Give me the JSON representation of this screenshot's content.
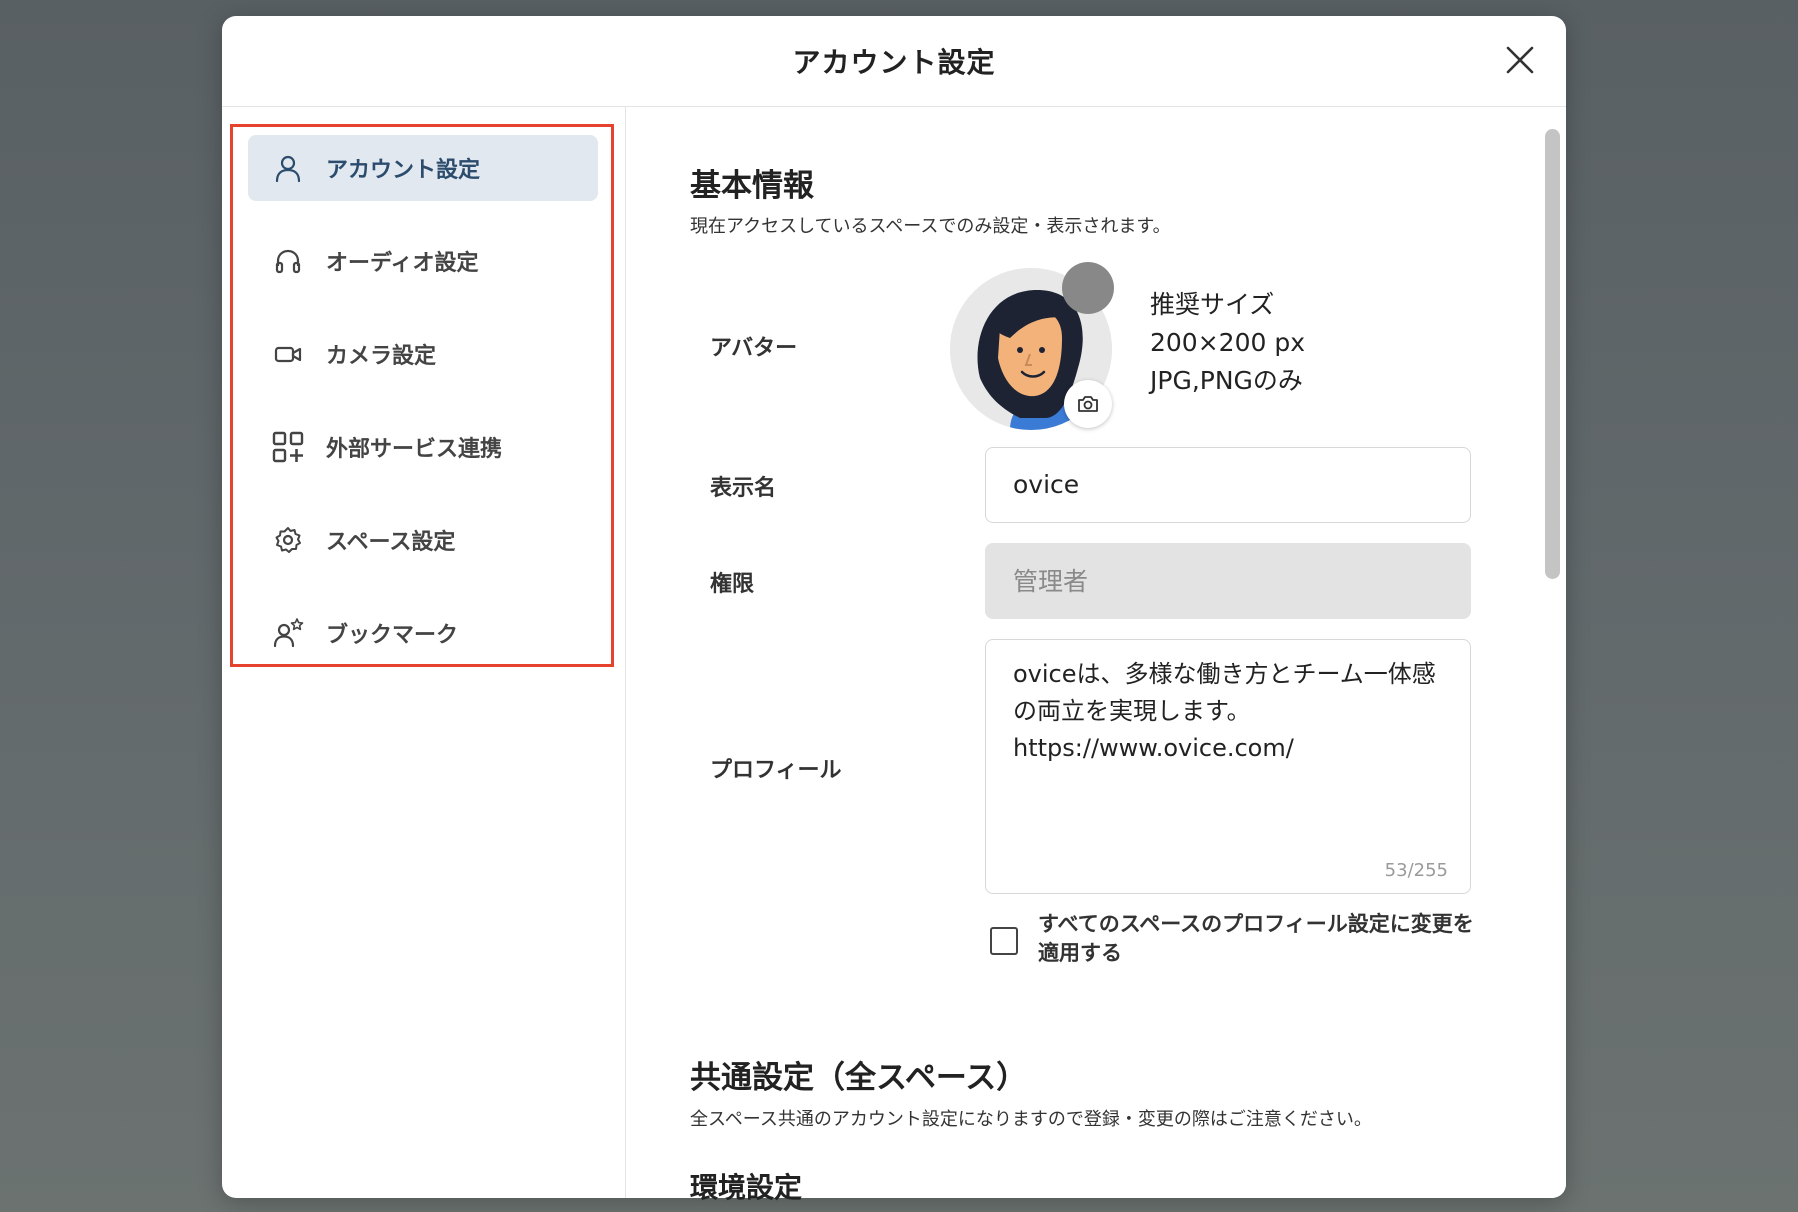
{
  "modal": {
    "title": "アカウント設定",
    "close_icon": "close-icon"
  },
  "sidebar": {
    "items": [
      {
        "label": "アカウント設定",
        "icon": "user-icon",
        "active": true
      },
      {
        "label": "オーディオ設定",
        "icon": "headphones-icon",
        "active": false
      },
      {
        "label": "カメラ設定",
        "icon": "video-camera-icon",
        "active": false
      },
      {
        "label": "外部サービス連携",
        "icon": "grid-plus-icon",
        "active": false
      },
      {
        "label": "スペース設定",
        "icon": "gear-icon",
        "active": false
      },
      {
        "label": "ブックマーク",
        "icon": "user-star-icon",
        "active": false
      }
    ]
  },
  "basic_info": {
    "title": "基本情報",
    "description": "現在アクセスしているスペースでのみ設定・表示されます。",
    "avatar_label": "アバター",
    "avatar_hint": [
      "推奨サイズ",
      "200×200 px",
      "JPG,PNGのみ"
    ],
    "display_name_label": "表示名",
    "display_name_value": "ovice",
    "role_label": "権限",
    "role_value": "管理者",
    "profile_label": "プロフィール",
    "profile_value": "oviceは、多様な働き方とチーム一体感\nの両立を実現します。\nhttps://www.ovice.com/",
    "profile_count": "53/255",
    "apply_all_label": "すべてのスペースのプロフィール設定に変更を適用する",
    "apply_all_checked": false
  },
  "common_settings": {
    "title": "共通設定（全スペース）",
    "description": "全スペース共通のアカウント設定になりますので登録・変更の際はご注意ください。",
    "env_title": "環境設定"
  },
  "colors": {
    "active_bg": "#e1e8ef",
    "active_text": "#2b4c6d",
    "highlight_border": "#e5432d"
  }
}
